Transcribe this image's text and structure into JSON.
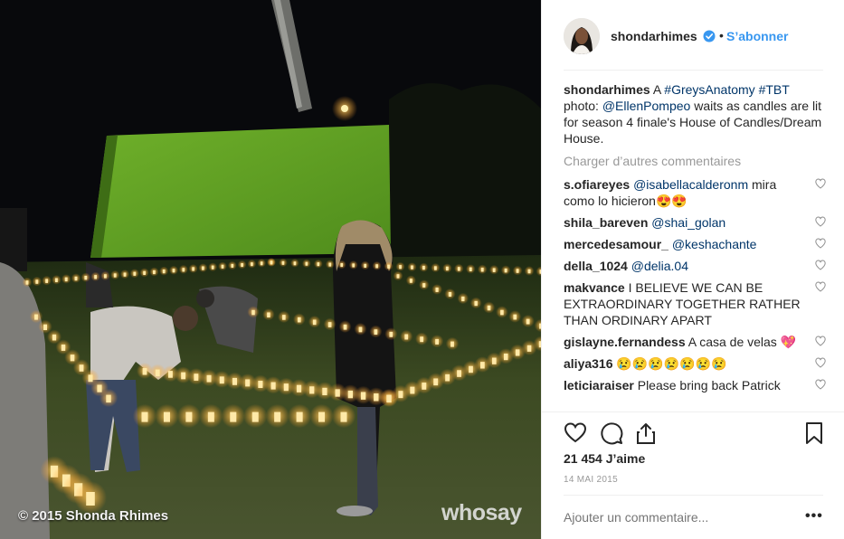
{
  "photo": {
    "copyright": "© 2015 Shonda Rhimes",
    "watermark": "whosay"
  },
  "header": {
    "username": "shondarhimes",
    "separator": "•",
    "follow_label": "S’abonner",
    "verified_color": "#3897f0"
  },
  "caption": {
    "username": "shondarhimes",
    "segments": [
      "A",
      "#GreysAnatomy",
      "#TBT",
      "photo:",
      "@EllenPompeo",
      "waits as candles are lit for season 4 finale's House of Candles/Dream House."
    ]
  },
  "load_more": "Charger d’autres commentaires",
  "comments": [
    {
      "username": "s.ofiareyes",
      "mention": "@isabellacalderonm",
      "text": "mira como lo hicieron😍😍"
    },
    {
      "username": "shila_bareven",
      "mention": "@shai_golan",
      "text": ""
    },
    {
      "username": "mercedesamour_",
      "mention": "@keshachante",
      "text": ""
    },
    {
      "username": "della_1024",
      "mention": "@delia.04",
      "text": ""
    },
    {
      "username": "makvance",
      "mention": "",
      "text": "I BELIEVE WE CAN BE EXTRAORDINARY TOGETHER RATHER THAN ORDINARY APART"
    },
    {
      "username": "gislayne.fernandess",
      "mention": "",
      "text": "A casa de velas 💖"
    },
    {
      "username": "aliya316",
      "mention": "",
      "text": "😢😢😢😢😢😢😢"
    },
    {
      "username": "leticiaraiser",
      "mention": "",
      "text": "Please bring back Patrick"
    }
  ],
  "icons": {
    "like": "heart-icon",
    "comment": "comment-bubble-icon",
    "share": "share-icon",
    "save": "bookmark-icon",
    "more": "more-options-icon"
  },
  "likes": "21 454 J’aime",
  "date": "14 MAI 2015",
  "add_comment": {
    "placeholder": "Ajouter un commentaire...",
    "more_label": "•••"
  },
  "colors": {
    "link": "#003569",
    "follow": "#3897f0",
    "muted": "#999999",
    "text": "#262626"
  }
}
